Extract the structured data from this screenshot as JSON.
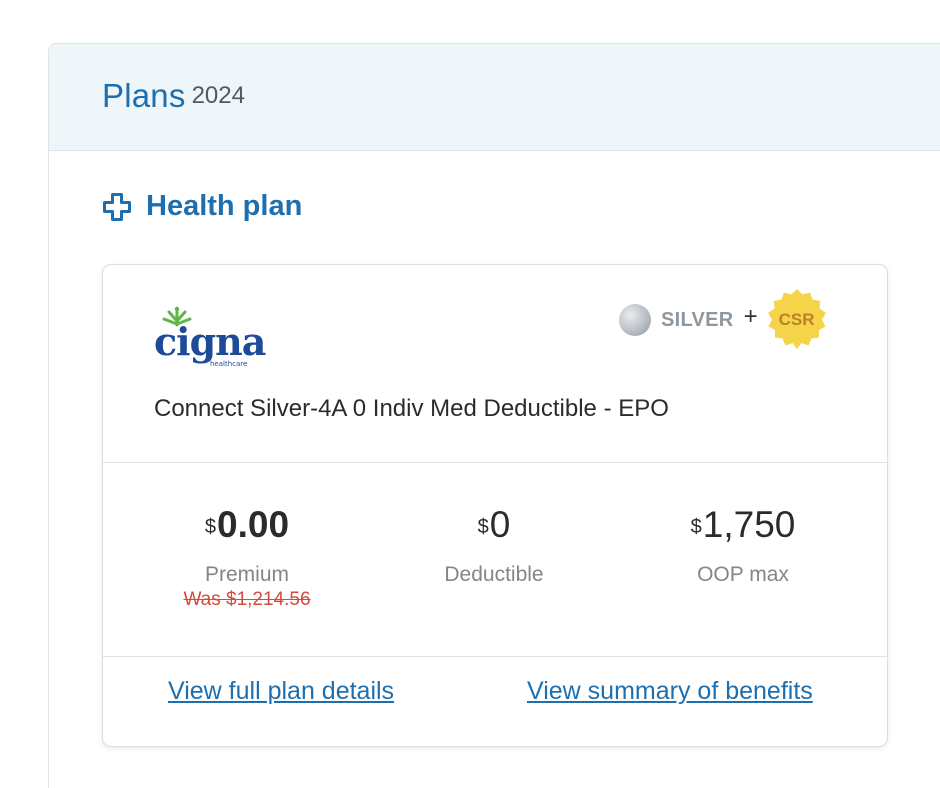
{
  "panel": {
    "title": "Plans",
    "year": "2024"
  },
  "section": {
    "title": "Health plan",
    "icon": "plus-outline-icon"
  },
  "plan": {
    "issuer": "cigna",
    "issuer_sub": "healthcare",
    "metal_level": "SILVER",
    "plus": "+",
    "badge": "CSR",
    "name": "Connect Silver-4A 0 Indiv Med Deductible - EPO"
  },
  "stats": {
    "premium": {
      "currency": "$",
      "value": "0.00",
      "label": "Premium",
      "was": "Was $1,214.56"
    },
    "deductible": {
      "currency": "$",
      "value": "0",
      "label": "Deductible"
    },
    "oop": {
      "currency": "$",
      "value": "1,750",
      "label": "OOP max"
    }
  },
  "links": {
    "full_details": "View full plan details",
    "summary": "View summary of benefits"
  },
  "colors": {
    "primary": "#1d6fb0",
    "header_bg": "#eef6fa",
    "silver": "#b9bfc5",
    "csr": "#f5d44a",
    "cigna_blue": "#1e4a9a",
    "cigna_green": "#5fb648",
    "was_red": "#d44b3b"
  }
}
